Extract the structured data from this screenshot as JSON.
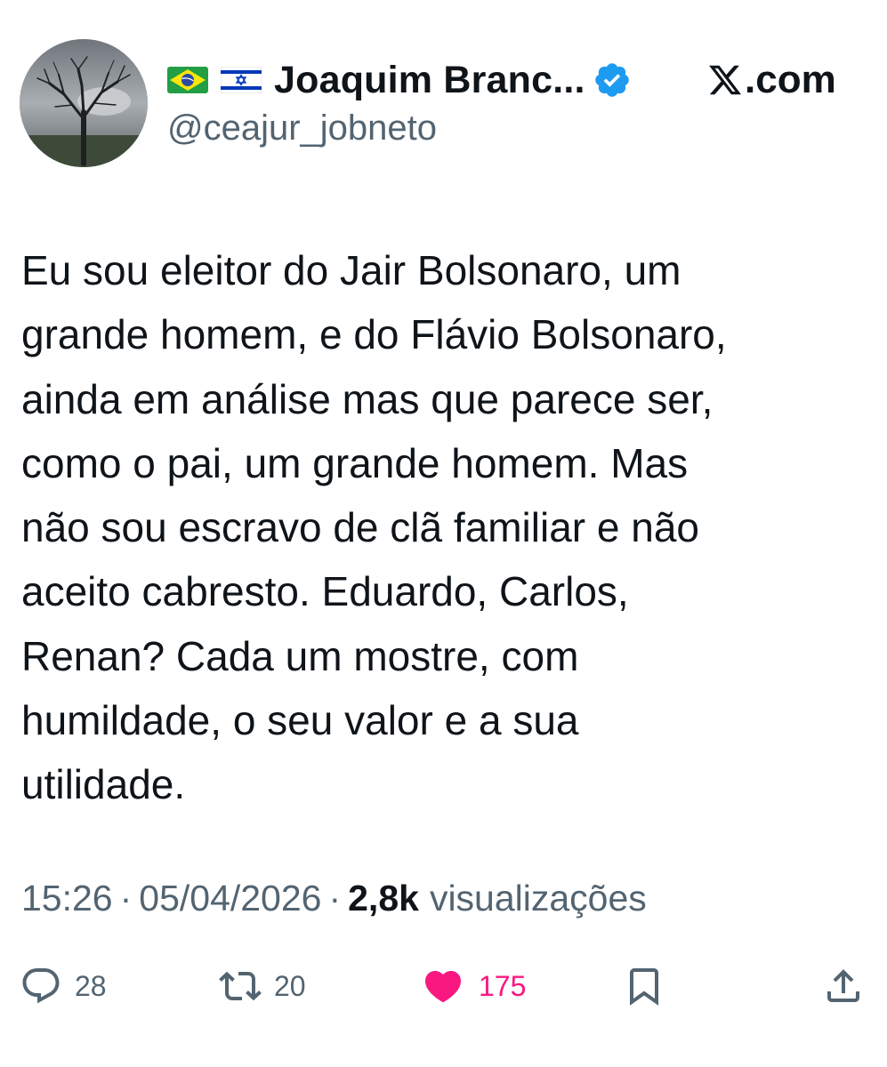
{
  "author": {
    "flags": [
      "brazil-flag-icon",
      "israel-flag-icon"
    ],
    "name": "Joaquim Branc...",
    "handle": "@ceajur_jobneto",
    "verified": true
  },
  "brand": {
    "logo": "x-logo-icon",
    "label": ".com"
  },
  "tweet": {
    "lines": [
      "Eu sou eleitor do Jair Bolsonaro, um",
      "grande homem, e do Flávio Bolsonaro,",
      "ainda em análise mas que parece ser,",
      "como o pai, um grande homem. Mas",
      "não sou escravo de clã familiar e não",
      "aceito cabresto. Eduardo, Carlos,",
      "Renan? Cada um mostre, com",
      "humildade, o seu valor e a sua",
      "utilidade."
    ]
  },
  "meta": {
    "time": "15:26",
    "separator": "·",
    "date": "05/04/2026",
    "views_count": "2,8k",
    "views_label": "visualizações"
  },
  "actions": {
    "replies": "28",
    "reposts": "20",
    "likes": "175",
    "liked": true,
    "icons": [
      "reply-icon",
      "repost-icon",
      "like-icon",
      "bookmark-icon",
      "share-icon"
    ]
  },
  "colors": {
    "text": "#0f1419",
    "secondary": "#536471",
    "verified": "#1d9bf0",
    "like": "#f91880"
  }
}
